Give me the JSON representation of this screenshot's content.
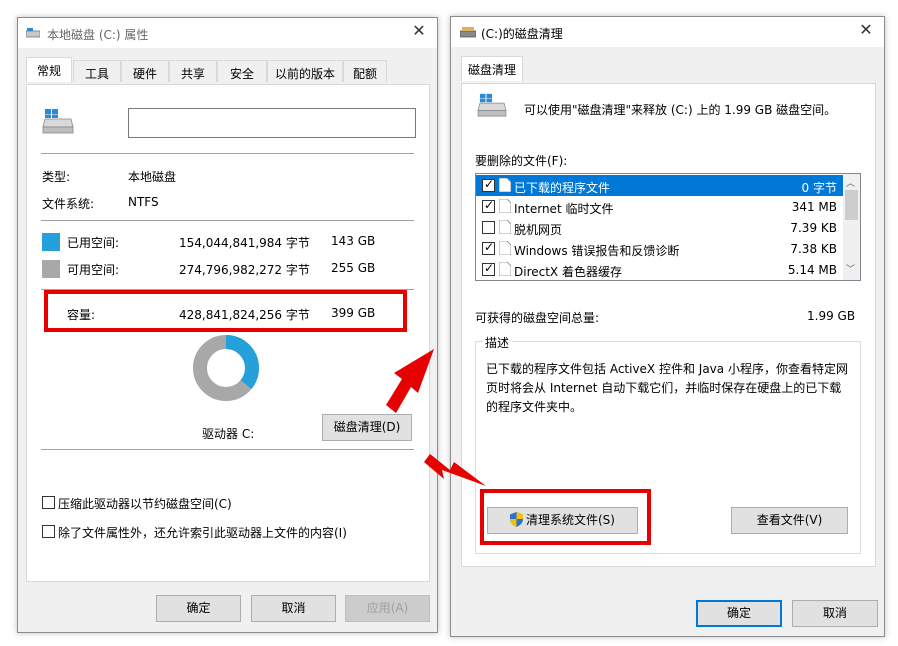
{
  "left_window": {
    "title": "本地磁盘 (C:) 属性",
    "tabs": [
      "常规",
      "工具",
      "硬件",
      "共享",
      "安全",
      "以前的版本",
      "配额"
    ],
    "name_value": "",
    "type_label": "类型:",
    "type_value": "本地磁盘",
    "fs_label": "文件系统:",
    "fs_value": "NTFS",
    "used": {
      "label": "已用空间:",
      "bytes": "154,044,841,984 字节",
      "size": "143 GB",
      "color": "#26a0da",
      "fraction": 0.359
    },
    "free": {
      "label": "可用空间:",
      "bytes": "274,796,982,272 字节",
      "size": "255 GB",
      "color": "#a8a8a8"
    },
    "capacity": {
      "label": "容量:",
      "bytes": "428,841,824,256 字节",
      "size": "399 GB"
    },
    "drive_label": "驱动器 C:",
    "cleanup_button": "磁盘清理(D)",
    "compress_label": "压缩此驱动器以节约磁盘空间(C)",
    "index_label": "除了文件属性外，还允许索引此驱动器上文件的内容(I)",
    "ok": "确定",
    "cancel": "取消",
    "apply": "应用(A)"
  },
  "right_window": {
    "title": "(C:)的磁盘清理",
    "tab": "磁盘清理",
    "intro": "可以使用\"磁盘清理\"来释放  (C:) 上的 1.99 GB 磁盘空间。",
    "files_label": "要删除的文件(F):",
    "files": [
      {
        "name": "已下载的程序文件",
        "size": "0 字节",
        "checked": true,
        "selected": true
      },
      {
        "name": "Internet 临时文件",
        "size": "341 MB",
        "checked": true,
        "selected": false
      },
      {
        "name": "脱机网页",
        "size": "7.39 KB",
        "checked": false,
        "selected": false
      },
      {
        "name": "Windows 错误报告和反馈诊断",
        "size": "7.38 KB",
        "checked": true,
        "selected": false
      },
      {
        "name": "DirectX 着色器缓存",
        "size": "5.14 MB",
        "checked": true,
        "selected": false
      }
    ],
    "total_label": "可获得的磁盘空间总量:",
    "total_value": "1.99 GB",
    "desc_title": "描述",
    "desc_text": "已下载的程序文件包括 ActiveX 控件和 Java 小程序，你查看特定网页时将会从 Internet 自动下载它们，并临时保存在硬盘上的已下载的程序文件夹中。",
    "clean_system_button": "清理系统文件(S)",
    "view_files_button": "查看文件(V)",
    "ok": "确定",
    "cancel": "取消"
  },
  "colors": {
    "highlight": "#e60000",
    "accent": "#0078d7"
  }
}
